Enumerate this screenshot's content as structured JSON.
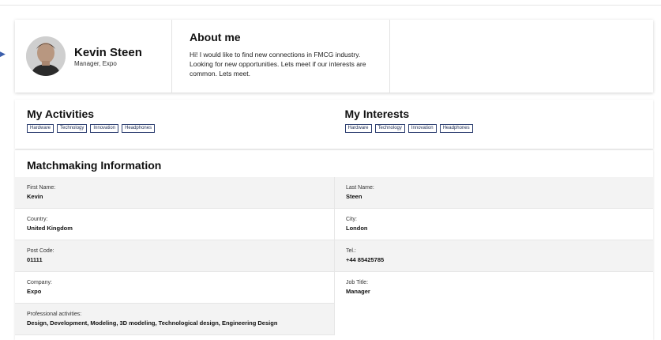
{
  "profile": {
    "name": "Kevin Steen",
    "role": "Manager, Expo",
    "about_title": "About me",
    "about_text": "Hi! I would like to find new connections in FMCG industry. Looking for new opportunities. Lets meet if our interests are common. Lets meet."
  },
  "activities": {
    "title": "My Activities",
    "tags": [
      "Hardware",
      "Technology",
      "Innovation",
      "Headphones"
    ]
  },
  "interests": {
    "title": "My Interests",
    "tags": [
      "Hardware",
      "Technology",
      "Innovation",
      "Headphones"
    ]
  },
  "matchmaking": {
    "title": "Matchmaking Information",
    "fields": {
      "first_name": {
        "label": "First Name:",
        "value": "Kevin"
      },
      "last_name": {
        "label": "Last Name:",
        "value": "Steen"
      },
      "country": {
        "label": "Country:",
        "value": "United Kingdom"
      },
      "city": {
        "label": "City:",
        "value": "London"
      },
      "post_code": {
        "label": "Post Code:",
        "value": "01111"
      },
      "tel": {
        "label": "Tel.:",
        "value": "+44 85425785"
      },
      "company": {
        "label": "Company:",
        "value": "Expo"
      },
      "job_title": {
        "label": "Job Title:",
        "value": "Manager"
      },
      "professional_activities": {
        "label": "Professional activities:",
        "value": "Design, Development, Modeling, 3D modeling, Technological design, Engineering Design"
      }
    }
  },
  "icons": {
    "left_arrow": "arrow-right-icon",
    "avatar": "user-avatar"
  },
  "colors": {
    "tag_border": "#2c3e70",
    "row_shade": "#f3f3f3"
  }
}
